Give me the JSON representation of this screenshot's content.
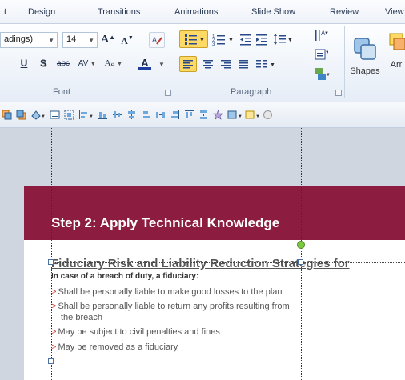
{
  "tabs": [
    "t",
    "Design",
    "Transitions",
    "Animations",
    "Slide Show",
    "Review",
    "View"
  ],
  "font": {
    "name_value": "adings)",
    "size_value": "14",
    "grow_label": "A",
    "shrink_label": "A",
    "underline_label": "U",
    "shadow_label": "S",
    "strike_label": "abc",
    "spacing_label": "AV",
    "case_label": "Aa",
    "color_label": "A",
    "group_label": "Font"
  },
  "paragraph": {
    "group_label": "Paragraph"
  },
  "drawing": {
    "shapes_label": "Shapes",
    "arrange_label": "Arr"
  },
  "slide": {
    "title": "Step 2: Apply Technical Knowledge",
    "subtitle": "Fiduciary Risk and Liability Reduction Strategies for",
    "case_line": "In case of a breach of duty, a fiduciary:",
    "bullet_marker": ">",
    "bullets": [
      "Shall be personally liable to make good losses to the plan",
      "Shall be personally liable to return any profits resulting from",
      "May  be subject to civil penalties and fines",
      "May  be removed as a fiduciary"
    ],
    "bullet2_continuation": "the breach"
  },
  "colors": {
    "title_band": "#8c1d40",
    "bullet_marker": "#c0392b",
    "ribbon_highlight": "#ffd966"
  },
  "icons": [
    "clear-format-icon",
    "bullets-icon",
    "numbering-icon",
    "decrease-indent-icon",
    "increase-indent-icon",
    "line-spacing-icon",
    "text-direction-icon",
    "align-text-icon",
    "smartart-icon",
    "align-left-icon",
    "center-icon",
    "align-right-icon",
    "justify-icon",
    "columns-icon",
    "shapes-icon",
    "arrange-icon"
  ]
}
